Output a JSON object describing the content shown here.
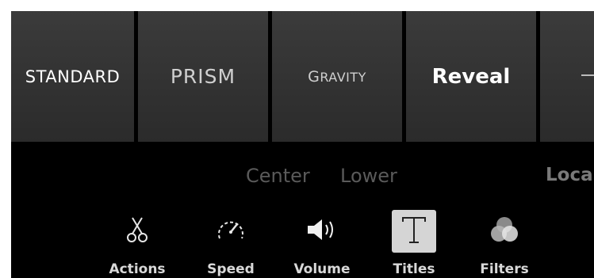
{
  "styles": {
    "tiles": [
      {
        "label": "STANDARD"
      },
      {
        "label": "PRISM"
      },
      {
        "label_first": "G",
        "label_rest": "RAVITY"
      },
      {
        "label": "Reveal"
      }
    ]
  },
  "positions": {
    "items": [
      "Center",
      "Lower",
      "Loca"
    ]
  },
  "toolbar": {
    "tools": [
      {
        "label": "Actions",
        "icon": "scissors-icon"
      },
      {
        "label": "Speed",
        "icon": "speedometer-icon"
      },
      {
        "label": "Volume",
        "icon": "speaker-icon"
      },
      {
        "label": "Titles",
        "icon": "text-t-icon",
        "selected": true
      },
      {
        "label": "Filters",
        "icon": "filters-icon"
      }
    ]
  },
  "colors": {
    "background": "#000000",
    "tile": "#333333",
    "selected_tool_bg": "#d5d5d5",
    "dim_text": "#5a5a5a"
  }
}
